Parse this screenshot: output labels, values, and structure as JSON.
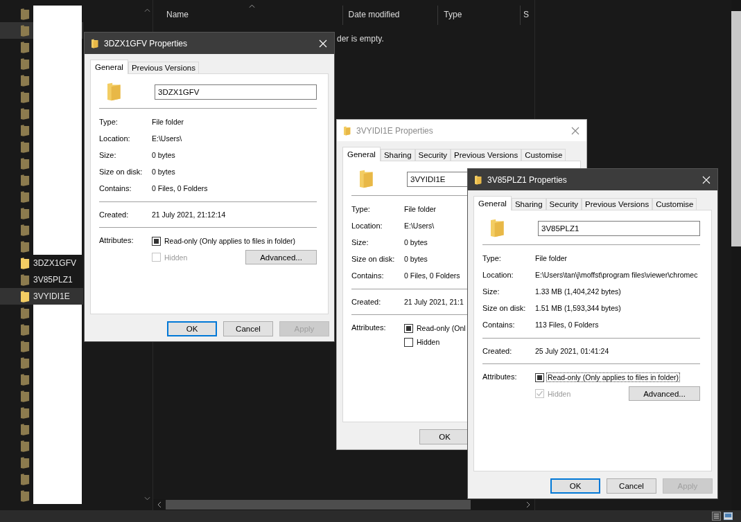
{
  "sidebar": {
    "items": [
      {
        "kind": "redacted",
        "hidden": true,
        "selected": false
      },
      {
        "kind": "redacted",
        "hidden": true,
        "selected": true
      },
      {
        "kind": "redacted",
        "hidden": true,
        "selected": false
      },
      {
        "kind": "redacted",
        "hidden": true,
        "selected": false
      },
      {
        "kind": "redacted",
        "hidden": true,
        "selected": false
      },
      {
        "kind": "redacted",
        "hidden": true,
        "selected": false
      },
      {
        "kind": "redacted",
        "hidden": true,
        "selected": false
      },
      {
        "kind": "redacted",
        "hidden": true,
        "selected": false
      },
      {
        "kind": "redacted",
        "hidden": true,
        "selected": false
      },
      {
        "kind": "redacted",
        "hidden": true,
        "selected": false
      },
      {
        "kind": "redacted",
        "hidden": true,
        "selected": false
      },
      {
        "kind": "redacted",
        "hidden": true,
        "selected": false
      },
      {
        "kind": "redacted",
        "hidden": true,
        "selected": false
      },
      {
        "kind": "redacted",
        "hidden": true,
        "selected": false
      },
      {
        "kind": "redacted",
        "hidden": true,
        "selected": false
      },
      {
        "kind": "folder",
        "name": "3DZX1GFV",
        "hidden": false,
        "selected": false
      },
      {
        "kind": "folder",
        "name": "3V85PLZ1",
        "hidden": true,
        "selected": false
      },
      {
        "kind": "folder",
        "name": "3VYIDI1E",
        "hidden": false,
        "selected": true
      },
      {
        "kind": "redacted",
        "hidden": true,
        "selected": false
      },
      {
        "kind": "redacted",
        "hidden": true,
        "selected": false
      },
      {
        "kind": "redacted",
        "hidden": true,
        "selected": false
      },
      {
        "kind": "redacted",
        "hidden": true,
        "selected": false
      },
      {
        "kind": "redacted",
        "hidden": true,
        "selected": false
      },
      {
        "kind": "redacted",
        "hidden": true,
        "selected": false
      },
      {
        "kind": "redacted",
        "hidden": true,
        "selected": false
      },
      {
        "kind": "redacted",
        "hidden": true,
        "selected": false
      },
      {
        "kind": "redacted",
        "hidden": true,
        "selected": false
      },
      {
        "kind": "redacted",
        "hidden": true,
        "selected": false
      },
      {
        "kind": "redacted",
        "hidden": true,
        "selected": false
      },
      {
        "kind": "redacted",
        "hidden": true,
        "selected": false
      }
    ]
  },
  "file_list": {
    "columns": [
      "Name",
      "Date modified",
      "Type",
      "S"
    ],
    "empty_message": "der is empty."
  },
  "dialogs": [
    {
      "title": "3DZX1GFV Properties",
      "active": true,
      "tabs": [
        {
          "label": "General",
          "selected": true
        },
        {
          "label": "Previous Versions",
          "selected": false
        }
      ],
      "name": "3DZX1GFV",
      "details": [
        {
          "label": "Type:",
          "value": "File folder"
        },
        {
          "label": "Location:",
          "value": "E:\\Users\\"
        },
        {
          "label": "Size:",
          "value": "0 bytes"
        },
        {
          "label": "Size on disk:",
          "value": "0 bytes"
        },
        {
          "label": "Contains:",
          "value": "0 Files, 0 Folders"
        }
      ],
      "created": {
        "label": "Created:",
        "value": "21 July 2021, 21:12:14"
      },
      "attributes": {
        "label": "Attributes:",
        "readonly": {
          "label": "Read-only (Only applies to files in folder)",
          "indeterminate": true,
          "disabled": false,
          "focused": false
        },
        "hidden": {
          "label": "Hidden",
          "checked": false,
          "disabled": true,
          "focused": false
        },
        "advanced": "Advanced..."
      },
      "buttons": [
        {
          "label": "OK",
          "default": true,
          "disabled": false
        },
        {
          "label": "Cancel",
          "default": false,
          "disabled": false
        },
        {
          "label": "Apply",
          "default": false,
          "disabled": true
        }
      ]
    },
    {
      "title": "3VYIDI1E Properties",
      "active": false,
      "tabs": [
        {
          "label": "General",
          "selected": true
        },
        {
          "label": "Sharing",
          "selected": false
        },
        {
          "label": "Security",
          "selected": false
        },
        {
          "label": "Previous Versions",
          "selected": false
        },
        {
          "label": "Customise",
          "selected": false
        }
      ],
      "name": "3VYIDI1E",
      "details": [
        {
          "label": "Type:",
          "value": "File folder"
        },
        {
          "label": "Location:",
          "value": "E:\\Users\\"
        },
        {
          "label": "Size:",
          "value": "0 bytes"
        },
        {
          "label": "Size on disk:",
          "value": "0 bytes"
        },
        {
          "label": "Contains:",
          "value": "0 Files, 0 Folders"
        }
      ],
      "created": {
        "label": "Created:",
        "value": "21 July 2021, 21:1"
      },
      "attributes": {
        "label": "Attributes:",
        "readonly": {
          "label": "Read-only (Onl",
          "indeterminate": true,
          "disabled": false,
          "focused": false
        },
        "hidden": {
          "label": "Hidden",
          "checked": false,
          "disabled": false,
          "focused": false
        }
      },
      "buttons": [
        {
          "label": "OK",
          "default": false,
          "disabled": false
        }
      ]
    },
    {
      "title": "3V85PLZ1 Properties",
      "active": true,
      "tabs": [
        {
          "label": "General",
          "selected": true
        },
        {
          "label": "Sharing",
          "selected": false
        },
        {
          "label": "Security",
          "selected": false
        },
        {
          "label": "Previous Versions",
          "selected": false
        },
        {
          "label": "Customise",
          "selected": false
        }
      ],
      "name": "3V85PLZ1",
      "details": [
        {
          "label": "Type:",
          "value": "File folder"
        },
        {
          "label": "Location:",
          "value": "E:\\Users\\tan\\j\\moffst\\program files\\viewer\\chromec"
        },
        {
          "label": "Size:",
          "value": "1.33 MB (1,404,242 bytes)"
        },
        {
          "label": "Size on disk:",
          "value": "1.51 MB (1,593,344 bytes)"
        },
        {
          "label": "Contains:",
          "value": "113 Files, 0 Folders"
        }
      ],
      "created": {
        "label": "Created:",
        "value": "25 July 2021, 01:41:24"
      },
      "attributes": {
        "label": "Attributes:",
        "readonly": {
          "label": "Read-only (Only applies to files in folder)",
          "indeterminate": true,
          "disabled": false,
          "focused": true
        },
        "hidden": {
          "label": "Hidden",
          "checked": true,
          "disabled": true,
          "focused": false
        },
        "advanced": "Advanced..."
      },
      "buttons": [
        {
          "label": "OK",
          "default": true,
          "disabled": false
        },
        {
          "label": "Cancel",
          "default": false,
          "disabled": false
        },
        {
          "label": "Apply",
          "default": false,
          "disabled": true
        }
      ]
    }
  ]
}
